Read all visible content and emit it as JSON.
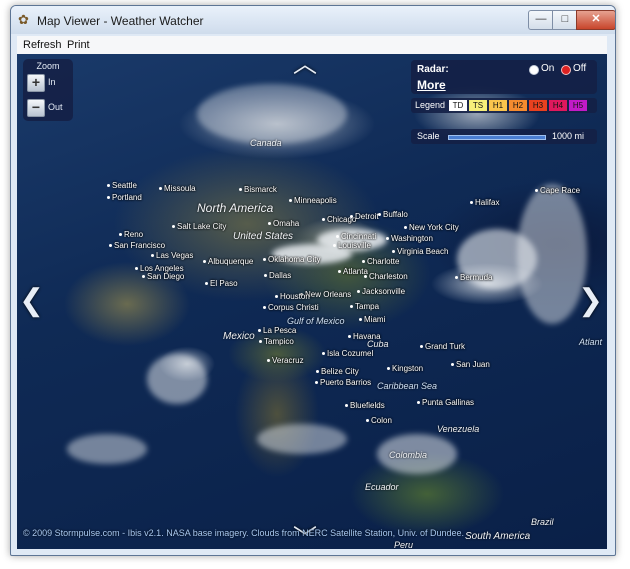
{
  "window": {
    "title": "Map Viewer - Weather Watcher",
    "controls": {
      "minimize": "—",
      "maximize": "□",
      "close": "✕"
    }
  },
  "menu": {
    "items": [
      "Refresh",
      "Print"
    ]
  },
  "zoom": {
    "header": "Zoom",
    "in_label": "In",
    "out_label": "Out",
    "plus": "+",
    "minus": "−"
  },
  "radar": {
    "label": "Radar:",
    "more": "More",
    "on_label": "On",
    "off_label": "Off",
    "selected": "Off"
  },
  "legend": {
    "label": "Legend",
    "items": [
      {
        "text": "TD",
        "color": "#ffffff"
      },
      {
        "text": "TS",
        "color": "#f7ef7a"
      },
      {
        "text": "H1",
        "color": "#f9c44d"
      },
      {
        "text": "H2",
        "color": "#f58b2f"
      },
      {
        "text": "H3",
        "color": "#e8411f"
      },
      {
        "text": "H4",
        "color": "#e0185d"
      },
      {
        "text": "H5",
        "color": "#c21ac7"
      }
    ]
  },
  "scale": {
    "label": "Scale",
    "value": "1000 mi"
  },
  "nav": {
    "up": "︿",
    "down": "﹀",
    "left": "❮",
    "right": "❯"
  },
  "regions": {
    "north_america": "North America",
    "united_states": "United States",
    "canada": "Canada",
    "mexico": "Mexico",
    "gulf_of_mexico": "Gulf of Mexico",
    "cuba": "Cuba",
    "caribbean_sea": "Caribbean Sea",
    "venezuela": "Venezuela",
    "colombia": "Colombia",
    "ecuador": "Ecuador",
    "peru": "Peru",
    "brazil": "Brazil",
    "south_america": "South America",
    "atlantic": "Atlant"
  },
  "cities": [
    "Seattle",
    "Portland",
    "Missoula",
    "Bismarck",
    "Minneapolis",
    "Chicago",
    "Detroit",
    "Buffalo",
    "Halifax",
    "Cape Race",
    "Omaha",
    "Salt Lake City",
    "Reno",
    "San Francisco",
    "Las Vegas",
    "Los Angeles",
    "San Diego",
    "Albuquerque",
    "El Paso",
    "Cincinnati",
    "Louisville",
    "Washington",
    "New York City",
    "Virginia Beach",
    "Charlotte",
    "Atlanta",
    "Charleston",
    "Oklahoma City",
    "Dallas",
    "Jacksonville",
    "New Orleans",
    "Houston",
    "Corpus Christi",
    "Tampa",
    "Miami",
    "Bermuda",
    "La Pesca",
    "Tampico",
    "Veracruz",
    "Havana",
    "Isla Cozumel",
    "Grand Turk",
    "Belize City",
    "Kingston",
    "San Juan",
    "Puerto Barrios",
    "Bluefields",
    "Colon",
    "Punta Gallinas"
  ],
  "footer": "© 2009 Stormpulse.com - Ibis v2.1. NASA base imagery. Clouds from NERC Satellite Station, Univ. of Dundee."
}
